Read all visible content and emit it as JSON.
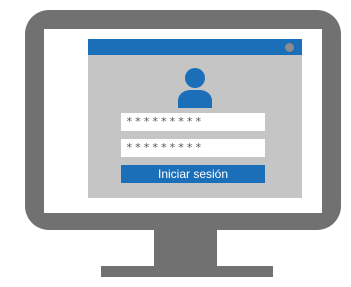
{
  "login_form": {
    "field_1_value": "*********",
    "field_2_value": "*********",
    "submit_label": "Iniciar sesión"
  },
  "icons": {
    "avatar": "user-avatar-icon",
    "window_control": "window-dot-icon"
  },
  "colors": {
    "monitor_frame": "#717171",
    "screen_background": "#ffffff",
    "window_background": "#c5c5c5",
    "accent": "#1a6fb8",
    "field_background": "#ffffff",
    "button_text": "#ffffff"
  }
}
